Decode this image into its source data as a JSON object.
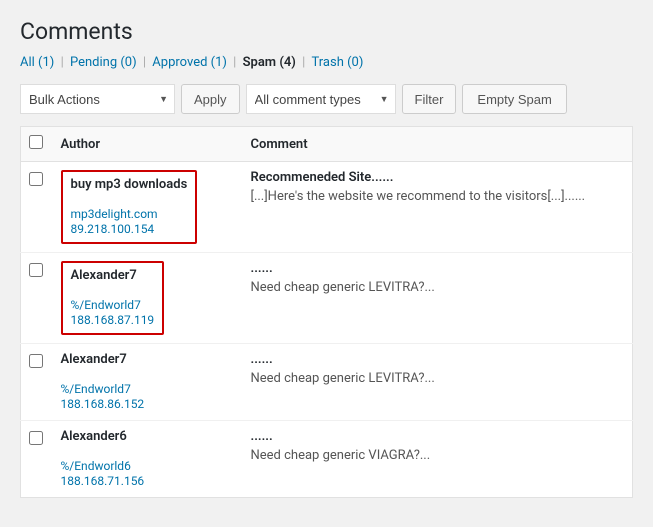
{
  "page": {
    "title": "Comments"
  },
  "filter_tabs": [
    {
      "label": "All",
      "count": "(1)",
      "id": "all",
      "active": false
    },
    {
      "label": "Pending",
      "count": "(0)",
      "id": "pending",
      "active": false
    },
    {
      "label": "Approved",
      "count": "(1)",
      "id": "approved",
      "active": false
    },
    {
      "label": "Spam",
      "count": "(4)",
      "id": "spam",
      "active": true
    },
    {
      "label": "Trash",
      "count": "(0)",
      "id": "trash",
      "active": false
    }
  ],
  "toolbar": {
    "bulk_actions_label": "Bulk Actions",
    "apply_label": "Apply",
    "comment_types_label": "All comment types",
    "filter_label": "Filter",
    "empty_spam_label": "Empty Spam"
  },
  "table": {
    "col_author": "Author",
    "col_comment": "Comment",
    "rows": [
      {
        "id": 1,
        "outlined": true,
        "author_name": "buy mp3 downloads",
        "author_site": "mp3delight.com",
        "author_ip": "89.218.100.154",
        "comment_title": "Recommeneded Site......",
        "comment_text": "[...]Here's the website we recommend to the visitors[...]......"
      },
      {
        "id": 2,
        "outlined": true,
        "author_name": "Alexander7",
        "author_site": "%/Endworld7",
        "author_ip": "188.168.87.119",
        "comment_title": "......",
        "comment_text": "Need cheap generic LEVITRA?..."
      },
      {
        "id": 3,
        "outlined": false,
        "author_name": "Alexander7",
        "author_site": "%/Endworld7",
        "author_ip": "188.168.86.152",
        "comment_title": "......",
        "comment_text": "Need cheap generic LEVITRA?..."
      },
      {
        "id": 4,
        "outlined": false,
        "author_name": "Alexander6",
        "author_site": "%/Endworld6",
        "author_ip": "188.168.71.156",
        "comment_title": "......",
        "comment_text": "Need cheap generic VIAGRA?..."
      }
    ]
  }
}
